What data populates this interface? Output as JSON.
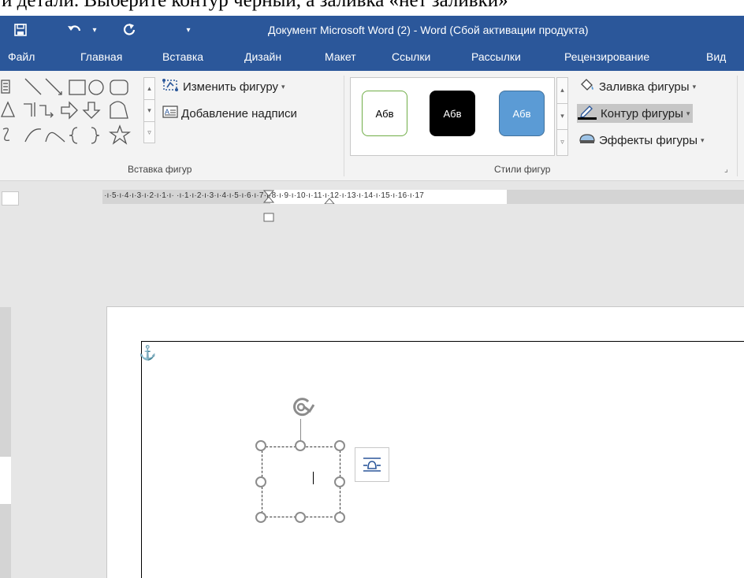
{
  "document": {
    "top_text_fragment": "и детали. Выберите контур черный, а заливка «нет заливки»"
  },
  "titlebar": {
    "title": "Документ Microsoft Word (2) - Word (Сбой активации продукта)",
    "qat_dropdown": "▾",
    "undo_dropdown": "▾"
  },
  "tabs": [
    "Файл",
    "Главная",
    "Вставка",
    "Дизайн",
    "Макет",
    "Ссылки",
    "Рассылки",
    "Рецензирование",
    "Вид"
  ],
  "ribbon": {
    "insert_shapes": {
      "edit_shape": "Изменить фигуру",
      "add_text": "Добавление надписи",
      "group_label": "Вставка фигур"
    },
    "shape_styles": {
      "preset_text": "Абв",
      "fill": "Заливка фигуры",
      "outline": "Контур фигуры",
      "effects": "Эффекты фигуры",
      "group_label": "Стили фигур"
    },
    "dropdown_arrow": "▾",
    "scroll_up": "▴",
    "scroll_down": "▾",
    "scroll_more": "▿",
    "launcher": "⌟"
  },
  "ruler": {
    "markings": "·ı·5·ı·4·ı·3·ı·2·ı·1·ı· ·ı·1·ı·2·ı·3·ı·4·ı·5·ı·6·ı·7·ı·8·ı·9·ı·10·ı·11·ı·12·ı·13·ı·14·ı·15·ı·16·ı·17"
  },
  "colors": {
    "accent": "#2b579a",
    "preset_1_border": "#70ad47",
    "preset_2_fill": "#000000",
    "preset_3_fill": "#5b9bd5"
  }
}
